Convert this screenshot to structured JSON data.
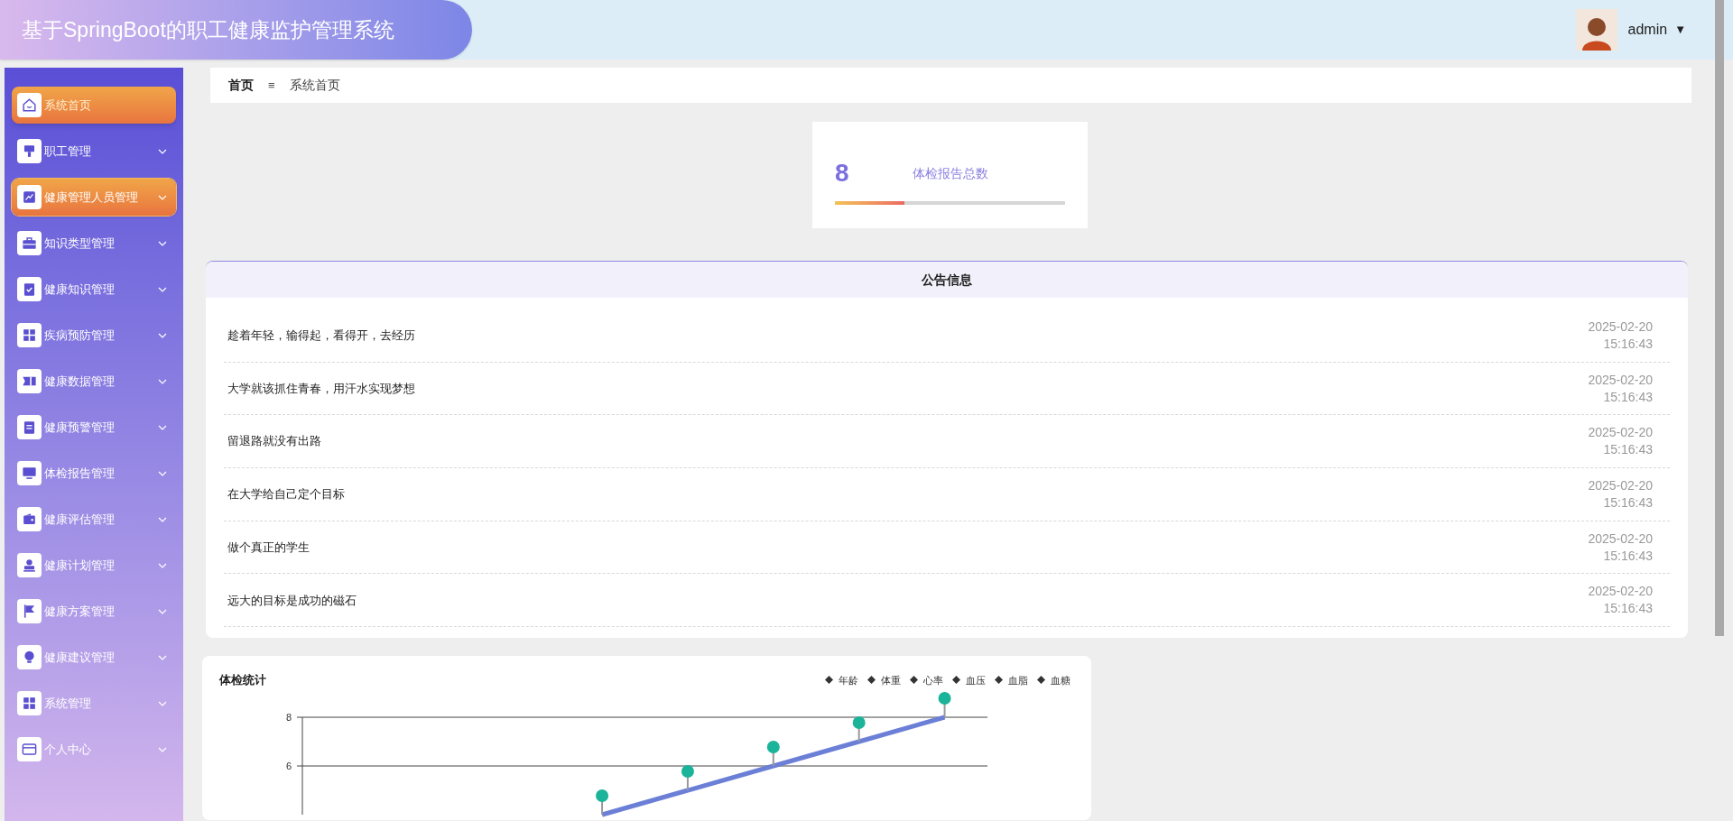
{
  "header": {
    "title": "基于SpringBoot的职工健康监护管理系统",
    "user": "admin",
    "menu_caret": "▼"
  },
  "sidebar": {
    "items": [
      {
        "label": "系统首页",
        "selected": true,
        "highlighted": false,
        "expandable": false
      },
      {
        "label": "职工管理",
        "selected": false,
        "highlighted": false,
        "expandable": true
      },
      {
        "label": "健康管理人员管理",
        "selected": false,
        "highlighted": true,
        "expandable": true
      },
      {
        "label": "知识类型管理",
        "selected": false,
        "highlighted": false,
        "expandable": true
      },
      {
        "label": "健康知识管理",
        "selected": false,
        "highlighted": false,
        "expandable": true
      },
      {
        "label": "疾病预防管理",
        "selected": false,
        "highlighted": false,
        "expandable": true
      },
      {
        "label": "健康数据管理",
        "selected": false,
        "highlighted": false,
        "expandable": true
      },
      {
        "label": "健康预警管理",
        "selected": false,
        "highlighted": false,
        "expandable": true
      },
      {
        "label": "体检报告管理",
        "selected": false,
        "highlighted": false,
        "expandable": true
      },
      {
        "label": "健康评估管理",
        "selected": false,
        "highlighted": false,
        "expandable": true
      },
      {
        "label": "健康计划管理",
        "selected": false,
        "highlighted": false,
        "expandable": true
      },
      {
        "label": "健康方案管理",
        "selected": false,
        "highlighted": false,
        "expandable": true
      },
      {
        "label": "健康建议管理",
        "selected": false,
        "highlighted": false,
        "expandable": true
      },
      {
        "label": "系统管理",
        "selected": false,
        "highlighted": false,
        "expandable": true
      },
      {
        "label": "个人中心",
        "selected": false,
        "highlighted": false,
        "expandable": true
      }
    ]
  },
  "breadcrumb": {
    "home": "首页",
    "separator": "≡",
    "current": "系统首页"
  },
  "stat_card": {
    "value": "8",
    "label": "体检报告总数",
    "level": 0.3
  },
  "notices": {
    "title": "公告信息",
    "rows": [
      {
        "title": "趁着年轻，输得起，看得开，去经历",
        "date": "2025-02-20",
        "time": "15:16:43"
      },
      {
        "title": "大学就该抓住青春，用汗水实现梦想",
        "date": "2025-02-20",
        "time": "15:16:43"
      },
      {
        "title": "留退路就没有出路",
        "date": "2025-02-20",
        "time": "15:16:43"
      },
      {
        "title": "在大学给自己定个目标",
        "date": "2025-02-20",
        "time": "15:16:43"
      },
      {
        "title": "做个真正的学生",
        "date": "2025-02-20",
        "time": "15:16:43"
      },
      {
        "title": "远大的目标是成功的磁石",
        "date": "2025-02-20",
        "time": "15:16:43"
      }
    ]
  },
  "chart_panel": {
    "legend": [
      "年龄",
      "体重",
      "心率",
      "血压",
      "血脂",
      "血糖"
    ],
    "chart_data": {
      "type": "line",
      "title": "体检统计",
      "ylim": [
        4,
        8
      ],
      "yticks": [
        6,
        8
      ],
      "series": [
        {
          "color": "#6b7fd7",
          "values": [
            null,
            null,
            null,
            4,
            5,
            6,
            7,
            8
          ]
        }
      ]
    }
  }
}
